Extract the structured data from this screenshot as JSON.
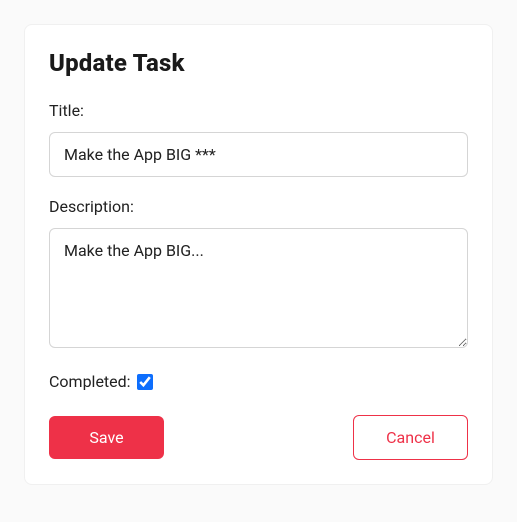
{
  "card": {
    "title": "Update Task"
  },
  "form": {
    "title_label": "Title:",
    "title_value": "Make the App BIG ***",
    "description_label": "Description:",
    "description_value": "Make the App BIG...",
    "completed_label": "Completed:",
    "completed_checked": true
  },
  "buttons": {
    "save": "Save",
    "cancel": "Cancel"
  }
}
